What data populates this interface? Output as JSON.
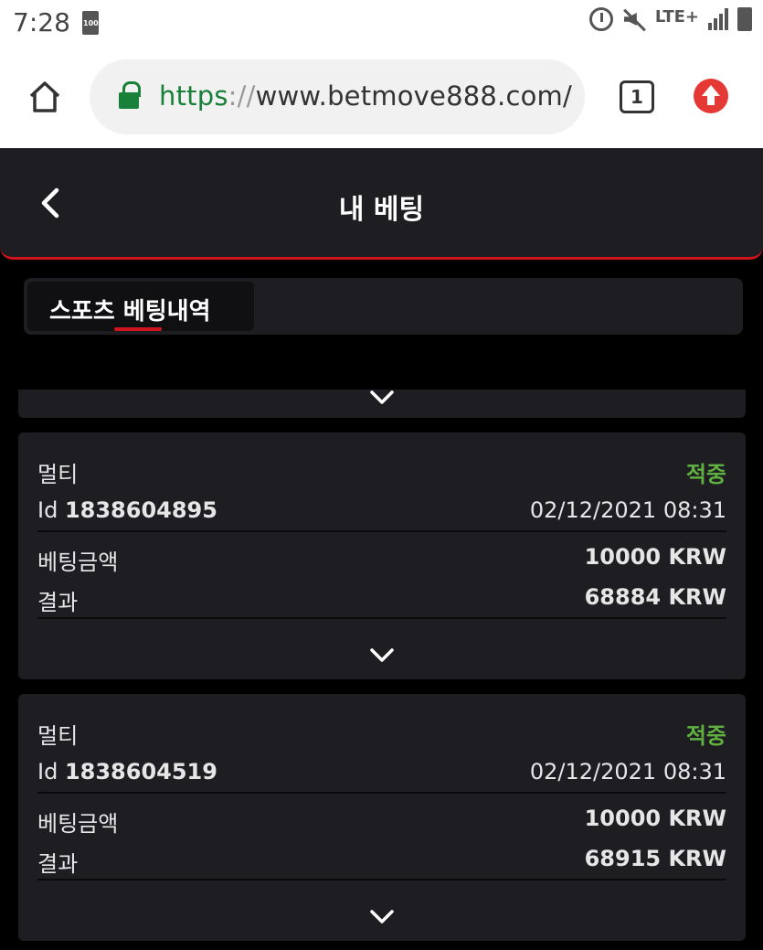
{
  "status_bar": {
    "time": "7:28",
    "battery_left": "100",
    "network": "LTE+",
    "icons": [
      "alarm-icon",
      "mute-icon",
      "lte-icon",
      "signal-icon",
      "battery-icon"
    ]
  },
  "browser": {
    "url_scheme": "https",
    "url_sep": "://",
    "url_host": "www.betmove888.com/",
    "tab_count": "1",
    "colors": {
      "secure": "#188038",
      "update": "#e53935"
    }
  },
  "header": {
    "title": "내 베팅"
  },
  "tabs": [
    {
      "label": "스포츠 베팅내역",
      "active": true
    }
  ],
  "colors": {
    "accent": "#d0141b",
    "won": "#5fb041",
    "card_bg": "#1e1e22"
  },
  "bets": [
    {
      "type": "멀티",
      "status": "적중",
      "id_label": "Id",
      "id": "1838604895",
      "datetime": "02/12/2021 08:31",
      "stake_label": "베팅금액",
      "stake": "10000 KRW",
      "result_label": "결과",
      "result": "68884 KRW"
    },
    {
      "type": "멀티",
      "status": "적중",
      "id_label": "Id",
      "id": "1838604519",
      "datetime": "02/12/2021 08:31",
      "stake_label": "베팅금액",
      "stake": "10000 KRW",
      "result_label": "결과",
      "result": "68915 KRW"
    }
  ]
}
